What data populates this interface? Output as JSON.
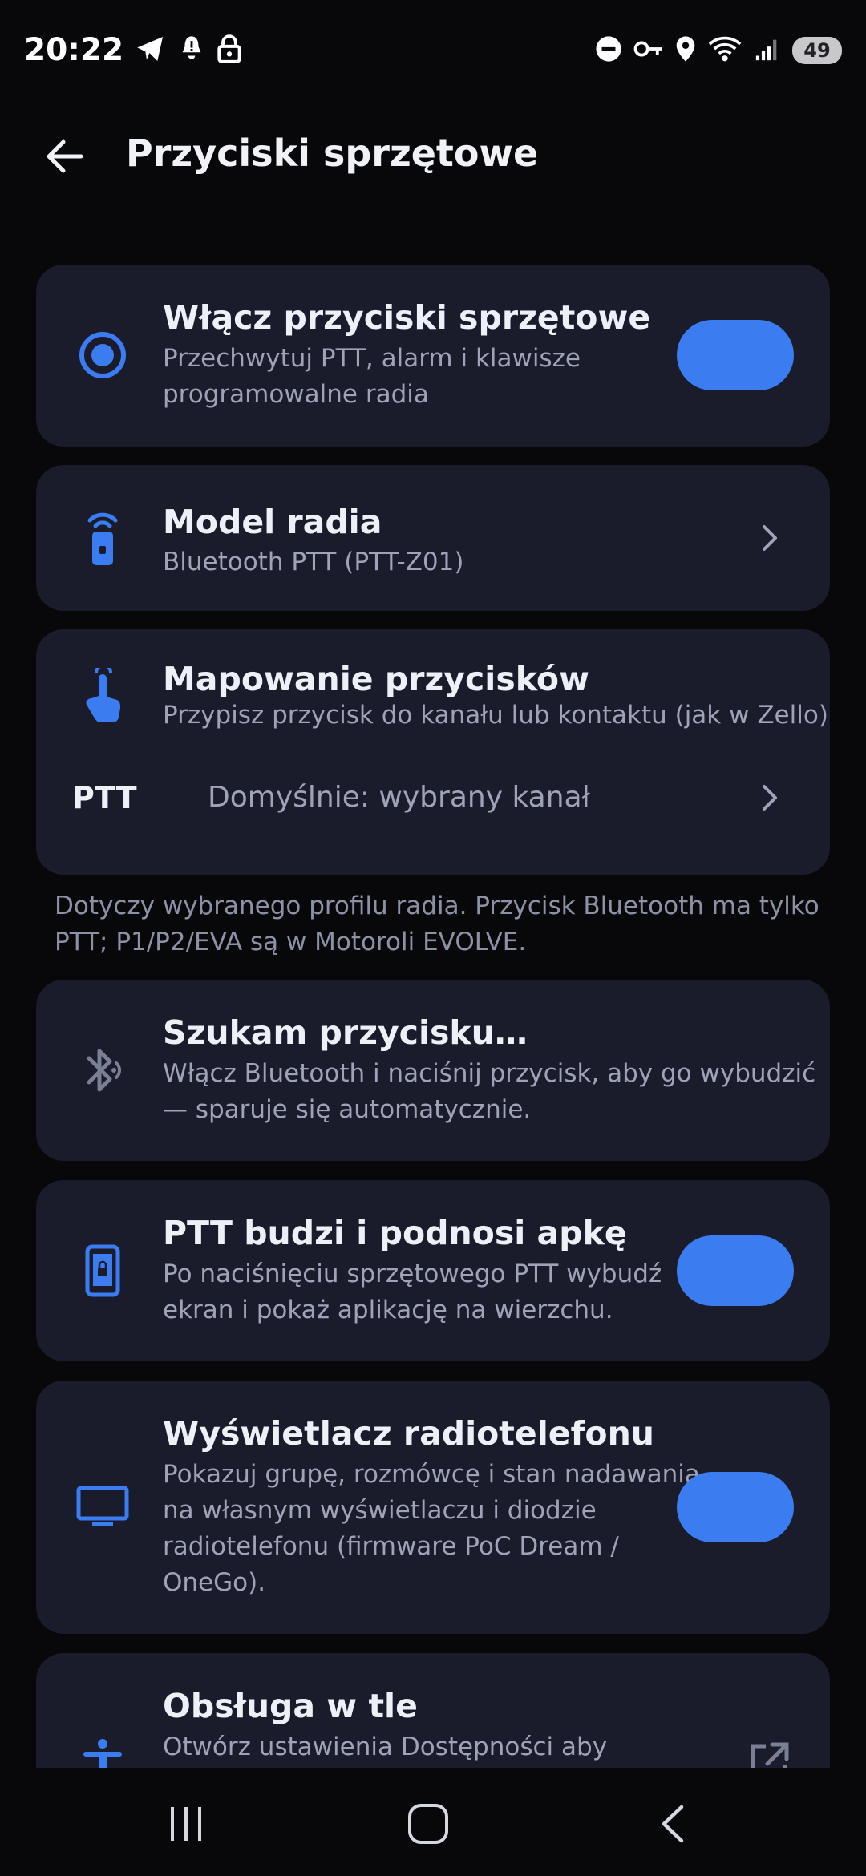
{
  "status_bar": {
    "time": "20:22",
    "battery": "49",
    "left_icons": [
      "telegram-icon",
      "bell-icon",
      "lock-icon"
    ],
    "right_icons": [
      "dnd-icon",
      "key-icon",
      "location-icon",
      "wifi-icon",
      "signal-icon"
    ]
  },
  "app_bar": {
    "title": "Przyciski sprzętowe"
  },
  "cards": {
    "enable": {
      "title": "Włącz przyciski sprzętowe",
      "subtitle_line1": "Przechwytuj PTT, alarm i klawisze",
      "subtitle_line2": "programowalne radia",
      "toggle_on": true
    },
    "model": {
      "title": "Model radia",
      "subtitle": "Bluetooth PTT (PTT-Z01)"
    },
    "mapping": {
      "title": "Mapowanie przycisków",
      "subtitle": "Przypisz przycisk do kanału lub kontaktu (jak w Zello)",
      "row_key": "PTT",
      "row_value": "Domyślnie: wybrany kanał"
    },
    "note_line1": "Dotyczy wybranego profilu radia. Przycisk Bluetooth ma tylko",
    "note_line2": "PTT; P1/P2/EVA są w Motoroli EVOLVE.",
    "searching": {
      "title": "Szukam przycisku…",
      "subtitle_line1": "Włącz Bluetooth i naciśnij przycisk, aby go wybudzić",
      "subtitle_line2": "— sparuje się automatycznie."
    },
    "wake": {
      "title": "PTT budzi i podnosi apkę",
      "subtitle_line1": "Po naciśnięciu sprzętowego PTT wybudź",
      "subtitle_line2": "ekran i pokaż aplikację na wierzchu.",
      "toggle_on": true
    },
    "display": {
      "title": "Wyświetlacz radiotelefonu",
      "subtitle_line1": "Pokazuj grupę, rozmówcę i stan nadawania",
      "subtitle_line2": "na własnym wyświetlaczu i diodzie",
      "subtitle_line3": "radiotelefonu (firmware PoC Dream /",
      "subtitle_line4": "OneGo).",
      "toggle_on": true
    },
    "background": {
      "title": "Obsługa w tle",
      "subtitle_line1": "Otwórz ustawienia Dostępności aby"
    }
  },
  "colors": {
    "accent": "#3b7cf0",
    "card_bg": "#1a1b2b",
    "page_bg": "#08080b"
  }
}
